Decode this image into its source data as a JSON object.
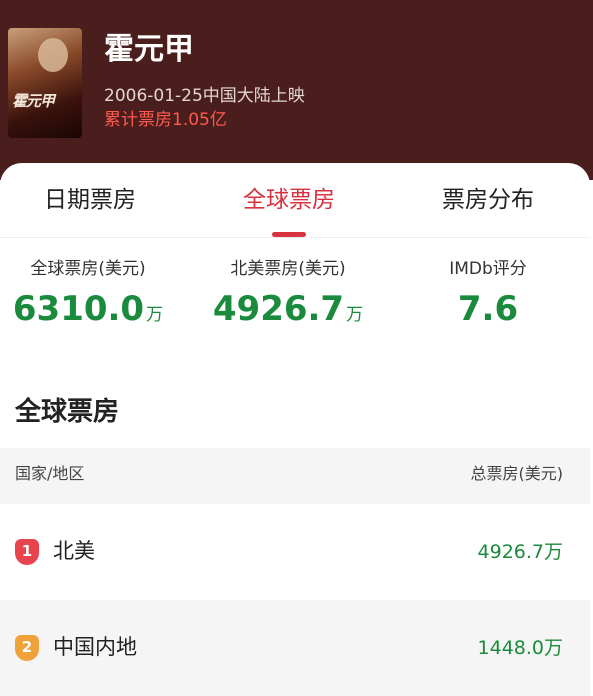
{
  "movie": {
    "title": "霍元甲",
    "poster_text": "霍元甲",
    "release": "2006-01-25中国大陆上映",
    "cumulative": "累计票房1.05亿"
  },
  "tabs": [
    {
      "label": "日期票房",
      "active": false
    },
    {
      "label": "全球票房",
      "active": true
    },
    {
      "label": "票房分布",
      "active": false
    }
  ],
  "stats": [
    {
      "label": "全球票房(美元)",
      "value": "6310.0",
      "unit": "万"
    },
    {
      "label": "北美票房(美元)",
      "value": "4926.7",
      "unit": "万"
    },
    {
      "label": "IMDb评分",
      "value": "7.6",
      "unit": ""
    }
  ],
  "section": {
    "title": "全球票房",
    "col_region": "国家/地区",
    "col_total": "总票房(美元)"
  },
  "rows": [
    {
      "rank": "1",
      "region": "北美",
      "amount": "4926.7万"
    },
    {
      "rank": "2",
      "region": "中国内地",
      "amount": "1448.0万"
    }
  ],
  "colors": {
    "header_bg": "#4a1e1c",
    "accent_red": "#d8323f",
    "value_green": "#1a8a3c",
    "rank1": "#e8444e",
    "rank2": "#f0a23a"
  }
}
